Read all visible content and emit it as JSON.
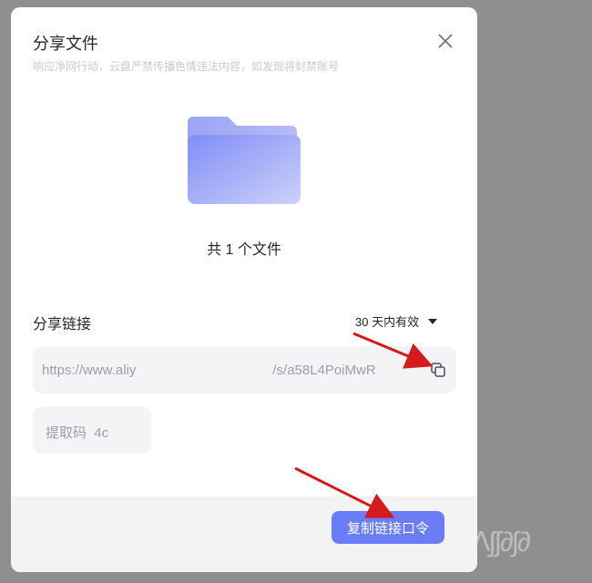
{
  "dialog": {
    "title": "分享文件",
    "subtitle": "响应净网行动，云盘严禁传播色情违法内容，如发现将封禁账号",
    "close_icon": "close-icon",
    "folder_icon": "folder-icon",
    "file_count": "共 1 个文件"
  },
  "share": {
    "label": "分享链接",
    "validity": "30 天内有效",
    "link_start": "https://www.aliy",
    "link_end": "/s/a58L4PoiMwR",
    "copy_icon": "copy-icon",
    "code_label": "提取码",
    "code_value": "4c"
  },
  "footer": {
    "copy_button": "复制链接口令"
  },
  "colors": {
    "accent": "#6b7df6",
    "annotation_arrow": "#d6191c",
    "folder_gradient_start": "#7f8ef7",
    "folder_gradient_end": "#cdd1f7"
  }
}
